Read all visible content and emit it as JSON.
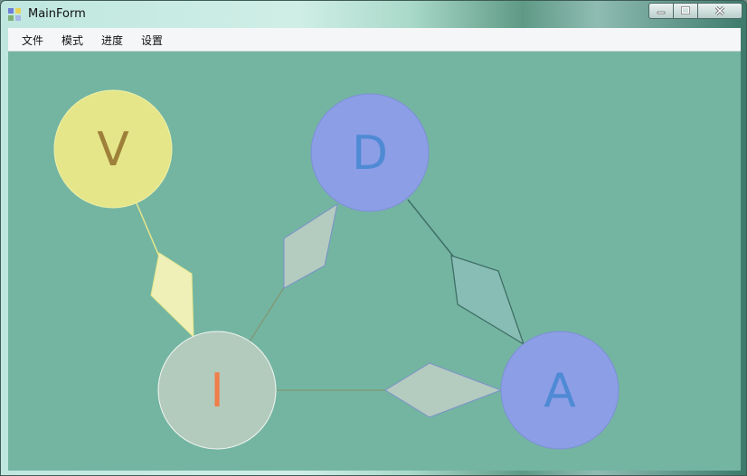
{
  "window": {
    "title": "MainForm"
  },
  "menu": {
    "items": [
      "文件",
      "模式",
      "进度",
      "设置"
    ]
  },
  "graph": {
    "nodes": {
      "V": "V",
      "D": "D",
      "I": "I",
      "A": "A"
    }
  },
  "colors": {
    "canvas_bg": "#74b5a2",
    "node_v": "#e5e68a",
    "node_d": "#8c9ee6",
    "node_i": "#b3cbbd",
    "node_a": "#8c9ee6",
    "text_v": "#9e803a",
    "text_d": "#4f8ad4",
    "text_i": "#f07d4a",
    "text_a": "#4f8ad4"
  }
}
